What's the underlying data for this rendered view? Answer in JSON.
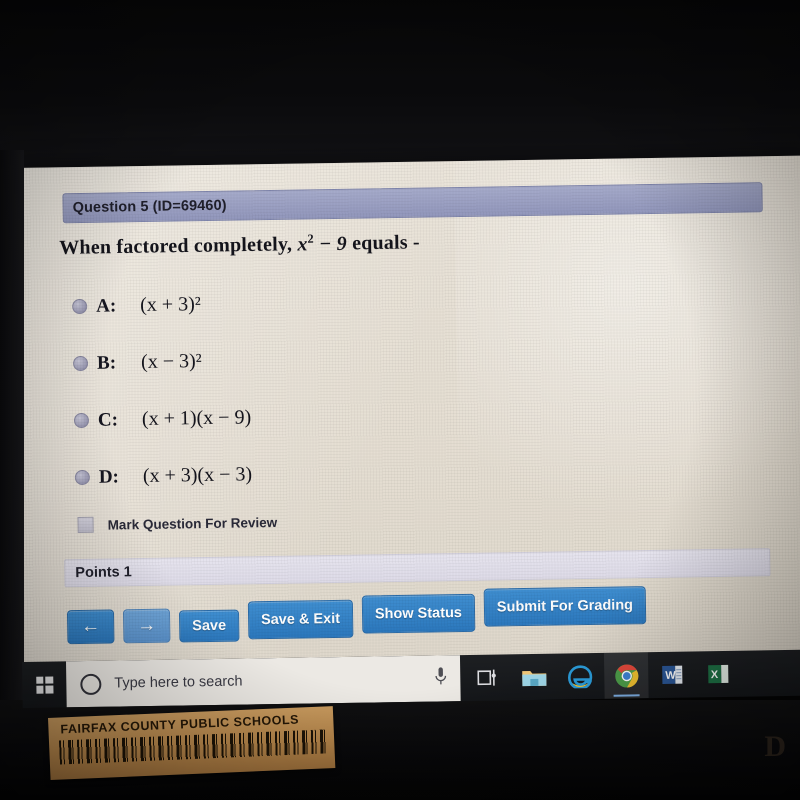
{
  "question": {
    "header_label": "Question 5 (ID=69460)",
    "prompt_prefix": "When factored completely,",
    "prompt_math_base": "x",
    "prompt_math_exp": "2",
    "prompt_math_rest": "− 9",
    "prompt_suffix": "equals -",
    "options": [
      {
        "letter": "A:",
        "expression": "(x + 3)²",
        "selected": false
      },
      {
        "letter": "B:",
        "expression": "(x − 3)²",
        "selected": false
      },
      {
        "letter": "C:",
        "expression": "(x + 1)(x − 9)",
        "selected": false
      },
      {
        "letter": "D:",
        "expression": "(x + 3)(x − 3)",
        "selected": false
      }
    ],
    "mark_for_review_label": "Mark Question For Review",
    "mark_for_review_checked": false,
    "points_label": "Points 1"
  },
  "toolbar": {
    "back_icon": "arrow-left-icon",
    "forward_icon": "arrow-right-icon",
    "save_label": "Save",
    "save_exit_label": "Save & Exit",
    "show_status_label": "Show Status",
    "submit_label": "Submit For Grading"
  },
  "taskbar": {
    "start_icon": "windows-logo-icon",
    "search_placeholder": "Type here to search",
    "search_icon": "search-circle-icon",
    "mic_icon": "microphone-icon",
    "items": [
      {
        "name": "task-view-icon",
        "label": "Task View"
      },
      {
        "name": "file-explorer-icon",
        "label": "File Explorer"
      },
      {
        "name": "internet-explorer-icon",
        "label": "Internet Explorer"
      },
      {
        "name": "chrome-icon",
        "label": "Google Chrome",
        "active": true
      },
      {
        "name": "word-icon",
        "label": "Word"
      },
      {
        "name": "excel-icon",
        "label": "Excel"
      }
    ]
  },
  "asset_sticker": {
    "text": "FAIRFAX COUNTY PUBLIC SCHOOLS"
  },
  "corner": {
    "mark": "D"
  },
  "colors": {
    "header_bar": "#9297bc",
    "button_blue": "#2c78bd",
    "page_bg": "#e5ded2",
    "sticker": "#b5854a"
  }
}
